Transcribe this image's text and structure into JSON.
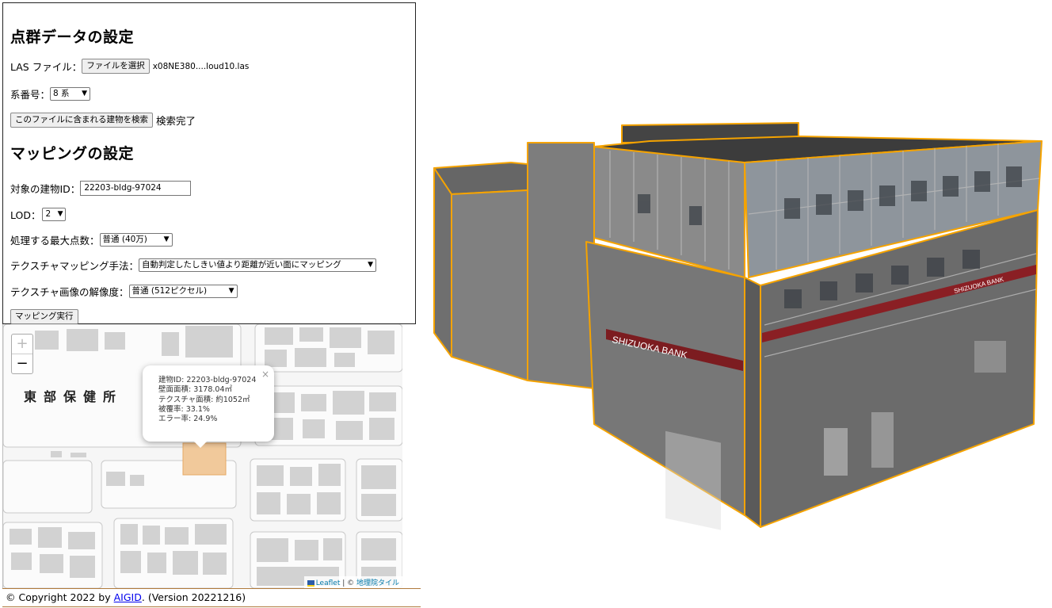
{
  "panel": {
    "pointcloud_title": "点群データの設定",
    "las_label": "LAS ファイル：",
    "file_button": "ファイルを選択",
    "file_name": "x08NE380....loud10.las",
    "zone_label": "系番号：",
    "zone_value": "8 系",
    "search_button": "このファイルに含まれる建物を検索",
    "search_status": "検索完了",
    "mapping_title": "マッピングの設定",
    "building_id_label": "対象の建物ID：",
    "building_id_value": "22203-bldg-97024",
    "lod_label": "LOD：",
    "lod_value": "2",
    "max_points_label": "処理する最大点数：",
    "max_points_value": "普通 (40万)",
    "method_label": "テクスチャマッピング手法：",
    "method_value": "自動判定したしきい値より距離が近い面にマッピング",
    "resolution_label": "テクスチャ画像の解像度：",
    "resolution_value": "普通 (512ピクセル)",
    "run_button": "マッピング実行"
  },
  "map": {
    "zoom_in": "+",
    "zoom_out": "−",
    "place_label": "東部保健所",
    "popup": {
      "close": "×",
      "building_id": "建物ID: 22203-bldg-97024",
      "wall_area": "壁面面積: 3178.04㎡",
      "texture_area": "テクスチャ面積: 約1052㎡",
      "coverage": "被覆率: 33.1%",
      "error_rate": "エラー率: 24.9%"
    },
    "attribution_leaflet": "Leaflet",
    "attribution_sep": " | © ",
    "attribution_gsi": "地理院タイル",
    "selected_color": "#f1c99b"
  },
  "footer": {
    "prefix": "© Copyright 2022 by ",
    "link": "AIGID",
    "suffix": ". (Version 20221216)"
  },
  "view3d": {
    "sign_text": "SHIZUOKA BANK",
    "sign_text_right": "SHIZUOKA BANK",
    "edge_color": "#f5a300",
    "wall_color": "#7f7f7f"
  }
}
